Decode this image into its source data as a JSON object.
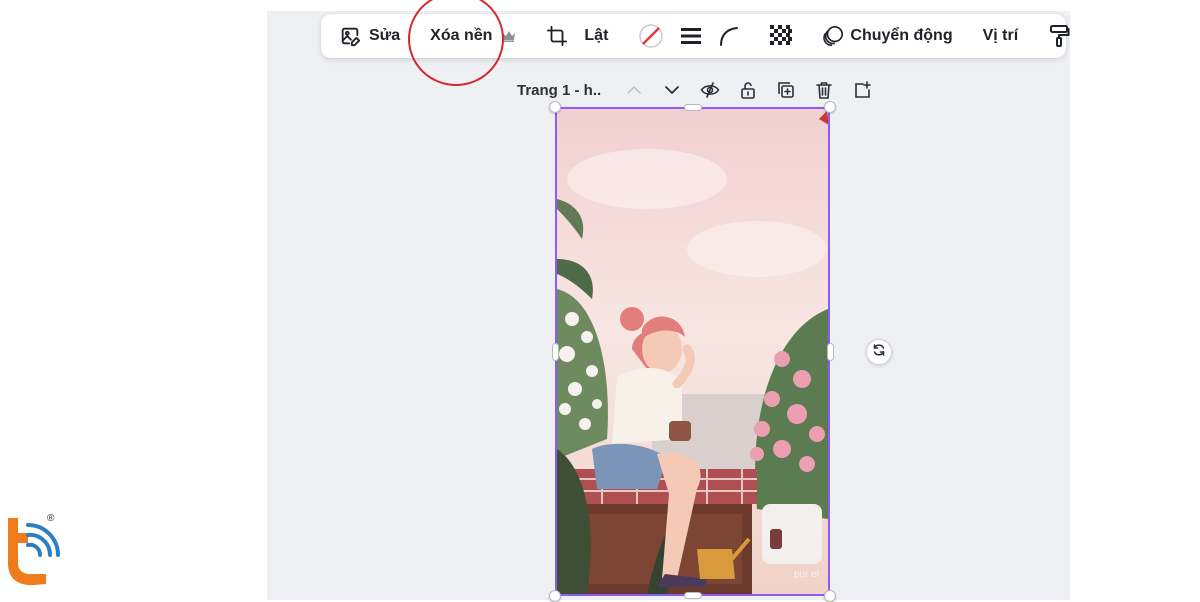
{
  "toolbar": {
    "edit_label": "Sửa",
    "remove_bg_label": "Xóa nền",
    "flip_label": "Lật",
    "animate_label": "Chuyển động",
    "position_label": "Vị trí"
  },
  "page": {
    "title": "Trang 1 - h.."
  },
  "artwork": {
    "signature": "pur el"
  },
  "logo": {
    "registered_mark": "®"
  },
  "colors": {
    "selection": "#8b5cf6",
    "annotation_circle": "#d4282e",
    "logo_orange": "#f07b1a",
    "logo_blue": "#2d7fc4",
    "canvas_bg": "#eef0f4"
  },
  "icons": [
    "image-edit-icon",
    "crown-icon",
    "crop-icon",
    "no-fill-icon",
    "border-style-icon",
    "corner-radius-icon",
    "transparency-icon",
    "animate-icon",
    "paint-roller-icon",
    "chevron-up-icon",
    "chevron-down-icon",
    "eye-hidden-icon",
    "lock-icon",
    "duplicate-icon",
    "trash-icon",
    "add-page-icon",
    "rotate-icon"
  ]
}
